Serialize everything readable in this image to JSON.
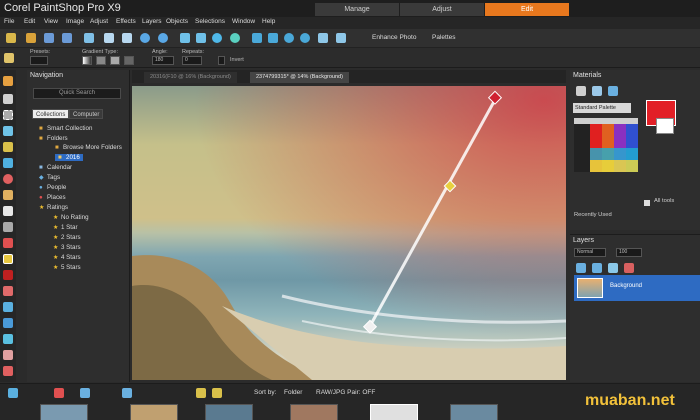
{
  "app": {
    "title": "Corel PaintShop Pro X9"
  },
  "mode_tabs": [
    {
      "label": "Manage"
    },
    {
      "label": "Adjust"
    },
    {
      "label": "Edit"
    }
  ],
  "menu": [
    "File",
    "Edit",
    "View",
    "Image",
    "Adjust",
    "Effects",
    "Layers",
    "Objects",
    "Selections",
    "Window",
    "Help"
  ],
  "toolbar": {
    "enhance_photo": "Enhance Photo",
    "palettes": "Palettes"
  },
  "tool_options": {
    "presets_label": "Presets:",
    "gradient_type_label": "Gradient Type:",
    "angle_label": "Angle:",
    "angle_value": "180",
    "repeats_label": "Repeats:",
    "repeats_value": "0",
    "invert_label": "Invert"
  },
  "navigation": {
    "title": "Navigation",
    "search_placeholder": "Quick Search",
    "tabs": [
      "Collections",
      "Computer"
    ],
    "tree": [
      {
        "label": "Smart Collection",
        "icon": "folder-icon",
        "indent": 1
      },
      {
        "label": "Folders",
        "icon": "folder-icon",
        "indent": 1
      },
      {
        "label": "Browse More Folders",
        "icon": "folder-plus-icon",
        "indent": 2
      },
      {
        "label": "2016",
        "icon": "folder-icon",
        "indent": 2,
        "selected": true
      },
      {
        "label": "Calendar",
        "icon": "calendar-icon",
        "indent": 1
      },
      {
        "label": "Tags",
        "icon": "tag-icon",
        "indent": 1
      },
      {
        "label": "People",
        "icon": "people-icon",
        "indent": 1
      },
      {
        "label": "Places",
        "icon": "pin-icon",
        "indent": 1
      },
      {
        "label": "Ratings",
        "icon": "star-icon",
        "indent": 1
      },
      {
        "label": "No Rating",
        "icon": "star-icon",
        "indent": 2
      },
      {
        "label": "1 Star",
        "icon": "star-icon",
        "indent": 2
      },
      {
        "label": "2 Stars",
        "icon": "star-icon",
        "indent": 2
      },
      {
        "label": "3 Stars",
        "icon": "star-icon",
        "indent": 2
      },
      {
        "label": "4 Stars",
        "icon": "star-icon",
        "indent": 2
      },
      {
        "label": "5 Stars",
        "icon": "star-icon",
        "indent": 2
      }
    ]
  },
  "documents": {
    "tabs": [
      {
        "label": "20316(F10 @ 16% (Background)"
      },
      {
        "label": "2374799315* @ 14% (Background)",
        "active": true
      }
    ]
  },
  "materials": {
    "title": "Materials",
    "palette": "Standard Palette",
    "foreground_color": "#e21f26",
    "background_color": "#ffffff",
    "all_tools_label": "All tools",
    "recently_used_label": "Recently Used"
  },
  "layers": {
    "title": "Layers",
    "blend_mode": "Normal",
    "opacity": "100",
    "layer_name": "Background"
  },
  "organizer": {
    "sort_by_label": "Sort by:",
    "sort_by_value": "Folder",
    "raw_label": "RAW/JPG Pair: OFF"
  },
  "watermark": "muaban.net",
  "colors": {
    "accent": "#e8781e",
    "selection": "#2e6bc2"
  }
}
